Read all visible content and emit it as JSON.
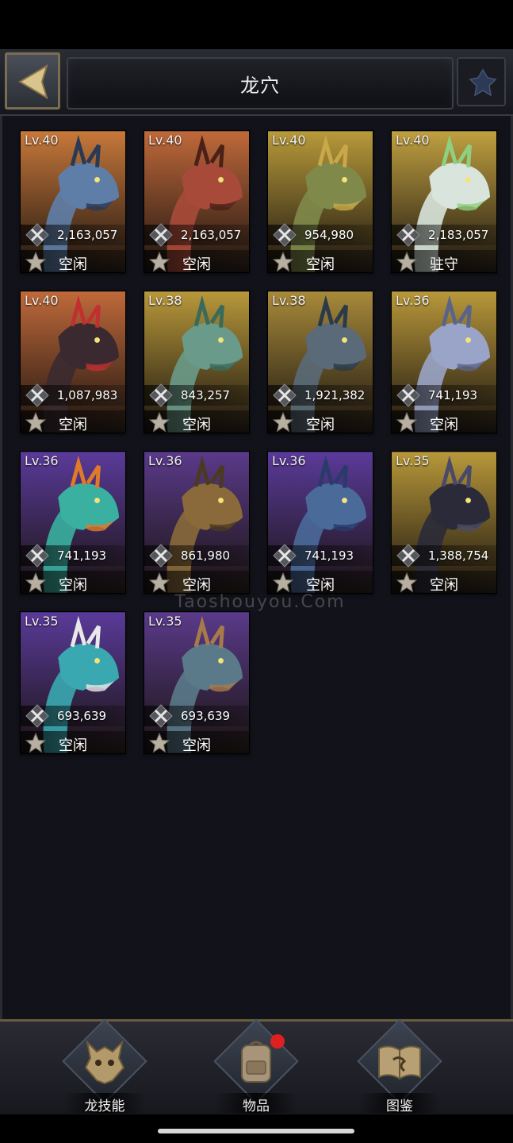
{
  "header": {
    "title": "龙穴"
  },
  "dragons": [
    {
      "level": "Lv.40",
      "power": "2,163,057",
      "status": "空闲",
      "bg": "#c8783a",
      "body": "#5e7ea8",
      "accent": "#2a3a55"
    },
    {
      "level": "Lv.40",
      "power": "2,163,057",
      "status": "空闲",
      "bg": "#c0693a",
      "body": "#a84a3a",
      "accent": "#4a2018"
    },
    {
      "level": "Lv.40",
      "power": "954,980",
      "status": "空闲",
      "bg": "#b89a3a",
      "body": "#7f8a4a",
      "accent": "#c8a84a"
    },
    {
      "level": "Lv.40",
      "power": "2,183,057",
      "status": "驻守",
      "bg": "#c0a040",
      "body": "#d8e4dc",
      "accent": "#8fd080"
    },
    {
      "level": "Lv.40",
      "power": "1,087,983",
      "status": "空闲",
      "bg": "#c0693a",
      "body": "#3a2a30",
      "accent": "#c03030"
    },
    {
      "level": "Lv.38",
      "power": "843,257",
      "status": "空闲",
      "bg": "#b8983a",
      "body": "#6a9a8a",
      "accent": "#3a6a5a"
    },
    {
      "level": "Lv.38",
      "power": "1,921,382",
      "status": "空闲",
      "bg": "#a88a3a",
      "body": "#5a6a78",
      "accent": "#2a3a48"
    },
    {
      "level": "Lv.36",
      "power": "741,193",
      "status": "空闲",
      "bg": "#b8983a",
      "body": "#9aa4c8",
      "accent": "#5a6488"
    },
    {
      "level": "Lv.36",
      "power": "741,193",
      "status": "空闲",
      "bg": "#5a3a9a",
      "body": "#3ab0a0",
      "accent": "#e07a2a"
    },
    {
      "level": "Lv.36",
      "power": "861,980",
      "status": "空闲",
      "bg": "#5a3a8a",
      "body": "#8a6a3a",
      "accent": "#4a3a20"
    },
    {
      "level": "Lv.36",
      "power": "741,193",
      "status": "空闲",
      "bg": "#5a3a9a",
      "body": "#4a6a9a",
      "accent": "#2a3a6a"
    },
    {
      "level": "Lv.35",
      "power": "1,388,754",
      "status": "空闲",
      "bg": "#b8983a",
      "body": "#2a2a38",
      "accent": "#4a4a68"
    },
    {
      "level": "Lv.35",
      "power": "693,639",
      "status": "空闲",
      "bg": "#5a3a9a",
      "body": "#3aa8b0",
      "accent": "#e8e8e8"
    },
    {
      "level": "Lv.35",
      "power": "693,639",
      "status": "空闲",
      "bg": "#5a3a8a",
      "body": "#5a7a8a",
      "accent": "#a87a4a"
    }
  ],
  "watermark": "Taoshouyou.Com",
  "nav": {
    "skills_label": "龙技能",
    "items_label": "物品",
    "codex_label": "图鉴"
  }
}
